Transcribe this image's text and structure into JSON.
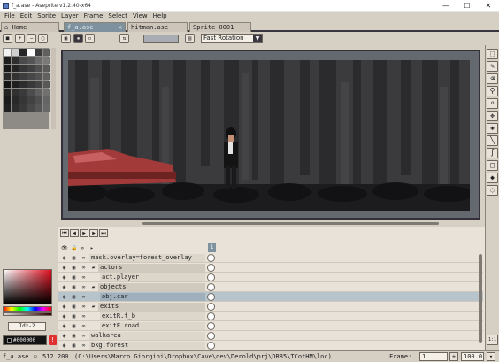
{
  "window": {
    "title": "f_a.ase - Aseprite v1.2.40-x64",
    "minimize": "—",
    "maximize": "☐",
    "close": "✕"
  },
  "menu": [
    "File",
    "Edit",
    "Sprite",
    "Layer",
    "Frame",
    "Select",
    "View",
    "Help"
  ],
  "tabs": [
    {
      "label": "Home",
      "icon": "home-icon"
    },
    {
      "label": "f_a.ase",
      "active": true
    },
    {
      "label": "hitman.ase"
    },
    {
      "label": "Sprite-0001"
    }
  ],
  "toolbar": {
    "rotation_algorithm": "Fast Rotation"
  },
  "colors": {
    "foreground_label": "#000000",
    "index_label": "Idx-2",
    "palette": [
      "#f2f2f2",
      "#cfcfcf",
      "#262626",
      "#ffffff",
      "#3c3c3c",
      "#606060",
      "#1d1d1d",
      "#2e2e2e",
      "#4a4a4a",
      "#555555",
      "#6b6b6b",
      "#7a7a7a",
      "#181818",
      "#242424",
      "#353535",
      "#404040",
      "#505050",
      "#5c5c5c",
      "#2a2a2a",
      "#333333",
      "#3d3d3d",
      "#474747",
      "#525252",
      "#616161",
      "#141414",
      "#1f1f1f",
      "#2c2c2c",
      "#383838",
      "#444444",
      "#585858",
      "#232323",
      "#303030",
      "#3a3a3a",
      "#4c4c4c",
      "#5f5f5f",
      "#707070",
      "#1a1a1a",
      "#282828",
      "#363636",
      "#424242",
      "#4f4f4f",
      "#646464",
      "#202020",
      "#2d2d2d",
      "#393939",
      "#484848",
      "#565656",
      "#686868"
    ],
    "scene_bg": "#3b3b3d",
    "car_red": "#a23a3a",
    "selection_blue": "#9fb0bc"
  },
  "timeline": {
    "current_frame": "1",
    "layers": [
      {
        "name": "mask.overlay=forest_overlay",
        "indent": 0
      },
      {
        "name": "actors",
        "indent": 0,
        "group": true
      },
      {
        "name": "act.player",
        "indent": 1
      },
      {
        "name": "objects",
        "indent": 0,
        "group": true
      },
      {
        "name": "obj.car",
        "indent": 1,
        "selected": true
      },
      {
        "name": "exits",
        "indent": 0,
        "group": true
      },
      {
        "name": "exitR.f_b",
        "indent": 1
      },
      {
        "name": "exitE.road",
        "indent": 1
      },
      {
        "name": "walkarea",
        "indent": 0
      },
      {
        "name": "bkg.forest",
        "indent": 0
      }
    ]
  },
  "status": {
    "filename": "f_a.ase",
    "size": "512 200",
    "path": "(C:\\Users\\Marco Giorgini\\Dropbox\\Cave\\dev\\Derold\\prj\\DR85\\TCotHM\\loc)",
    "frame_label": "Frame:",
    "frame_value": "1",
    "zoom": "100.0",
    "right_icon": "1:1"
  }
}
